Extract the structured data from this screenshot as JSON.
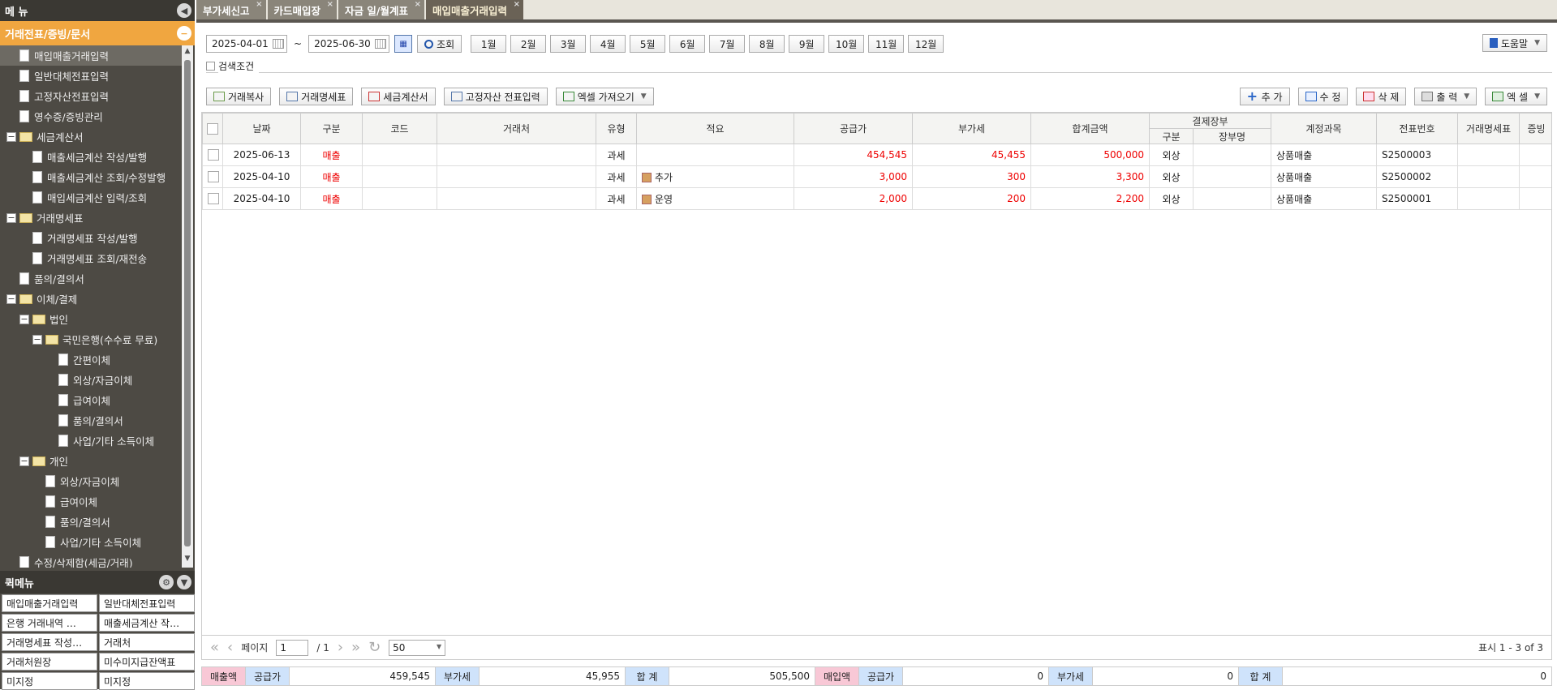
{
  "sidebar": {
    "title": "메 뉴",
    "section": "거래전표/증빙/문서",
    "tree": [
      {
        "label": "매입매출거래입력",
        "level": 1,
        "kind": "file",
        "selected": true
      },
      {
        "label": "일반대체전표입력",
        "level": 1,
        "kind": "file"
      },
      {
        "label": "고정자산전표입력",
        "level": 1,
        "kind": "file"
      },
      {
        "label": "영수증/증빙관리",
        "level": 1,
        "kind": "file"
      },
      {
        "label": "세금계산서",
        "level": 0,
        "kind": "folder"
      },
      {
        "label": "매출세금계산 작성/발행",
        "level": 2,
        "kind": "file"
      },
      {
        "label": "매출세금계산 조회/수정발행",
        "level": 2,
        "kind": "file"
      },
      {
        "label": "매입세금계산 입력/조회",
        "level": 2,
        "kind": "file"
      },
      {
        "label": "거래명세표",
        "level": 0,
        "kind": "folder"
      },
      {
        "label": "거래명세표 작성/발행",
        "level": 2,
        "kind": "file"
      },
      {
        "label": "거래명세표 조회/재전송",
        "level": 2,
        "kind": "file"
      },
      {
        "label": "품의/결의서",
        "level": 1,
        "kind": "file"
      },
      {
        "label": "이체/결제",
        "level": 0,
        "kind": "folder"
      },
      {
        "label": "법인",
        "level": 1,
        "kind": "folder"
      },
      {
        "label": "국민은행(수수료 무료)",
        "level": 2,
        "kind": "folder"
      },
      {
        "label": "간편이체",
        "level": 4,
        "kind": "file"
      },
      {
        "label": "외상/자금이체",
        "level": 4,
        "kind": "file"
      },
      {
        "label": "급여이체",
        "level": 4,
        "kind": "file"
      },
      {
        "label": "품의/결의서",
        "level": 4,
        "kind": "file"
      },
      {
        "label": "사업/기타 소득이체",
        "level": 4,
        "kind": "file"
      },
      {
        "label": "개인",
        "level": 1,
        "kind": "folder"
      },
      {
        "label": "외상/자금이체",
        "level": 3,
        "kind": "file"
      },
      {
        "label": "급여이체",
        "level": 3,
        "kind": "file"
      },
      {
        "label": "품의/결의서",
        "level": 3,
        "kind": "file"
      },
      {
        "label": "사업/기타 소득이체",
        "level": 3,
        "kind": "file"
      },
      {
        "label": "수정/삭제함(세금/거래)",
        "level": 1,
        "kind": "file"
      }
    ],
    "quick_title": "퀵메뉴",
    "quick": [
      "매입매출거래입력",
      "일반대체전표입력",
      "은행 거래내역 …",
      "매출세금계산 작…",
      "거래명세표 작성…",
      "거래처",
      "거래처원장",
      "미수미지급잔액표",
      "미지정",
      "미지정"
    ]
  },
  "tabs": [
    {
      "label": "부가세신고",
      "active": false
    },
    {
      "label": "카드매입장",
      "active": false
    },
    {
      "label": "자금 일/월계표",
      "active": false
    },
    {
      "label": "매입매출거래입력",
      "active": true
    }
  ],
  "filters": {
    "date_from": "2025-04-01",
    "tilde": "~",
    "date_to": "2025-06-30",
    "search_label": "조회",
    "months": [
      "1월",
      "2월",
      "3월",
      "4월",
      "5월",
      "6월",
      "7월",
      "8월",
      "9월",
      "10월",
      "11월",
      "12월"
    ],
    "help_label": "도움말",
    "search_conditions": "검색조건"
  },
  "toolbar": {
    "left": [
      "거래복사",
      "거래명세표",
      "세금계산서",
      "고정자산 전표입력",
      "엑셀 가져오기"
    ],
    "add": "추 가",
    "edit": "수 정",
    "delete": "삭 제",
    "print": "출 력",
    "excel": "엑 셀"
  },
  "table": {
    "headers": {
      "date": "날짜",
      "type": "구분",
      "code": "코드",
      "client": "거래처",
      "tax_type": "유형",
      "memo": "적요",
      "supply": "공급가",
      "vat": "부가세",
      "total": "합계금액",
      "payment": "결제장부",
      "pay_type": "구분",
      "ledger": "장부명",
      "account": "계정과목",
      "voucher": "전표번호",
      "statement": "거래명세표",
      "proof": "증빙"
    },
    "rows": [
      {
        "date": "2025-06-13",
        "type": "매출",
        "code": "",
        "client": "",
        "tax_type": "과세",
        "memo": "",
        "supply": "454,545",
        "vat": "45,455",
        "total": "500,000",
        "pay_type": "외상",
        "ledger": "",
        "account": "상품매출",
        "voucher": "S2500003"
      },
      {
        "date": "2025-04-10",
        "type": "매출",
        "code": "",
        "client": "",
        "tax_type": "과세",
        "memo": "추가",
        "supply": "3,000",
        "vat": "300",
        "total": "3,300",
        "pay_type": "외상",
        "ledger": "",
        "account": "상품매출",
        "voucher": "S2500002"
      },
      {
        "date": "2025-04-10",
        "type": "매출",
        "code": "",
        "client": "",
        "tax_type": "과세",
        "memo": "운영",
        "supply": "2,000",
        "vat": "200",
        "total": "2,200",
        "pay_type": "외상",
        "ledger": "",
        "account": "상품매출",
        "voucher": "S2500001"
      }
    ]
  },
  "pager": {
    "page_label": "페이지",
    "page": "1",
    "of": "/ 1",
    "page_size": "50",
    "display": "표시 1 - 3 of 3"
  },
  "summary": {
    "sales_label": "매출액",
    "supply_label": "공급가",
    "sales_supply": "459,545",
    "vat_label": "부가세",
    "sales_vat": "45,955",
    "total_label": "합 계",
    "sales_total": "505,500",
    "purchase_label": "매입액",
    "purchase_supply": "0",
    "purchase_vat": "0",
    "purchase_total": "0"
  },
  "colors": {
    "accent": "#f0a640",
    "sidebar": "#4d4a44",
    "red": "#e00000"
  }
}
